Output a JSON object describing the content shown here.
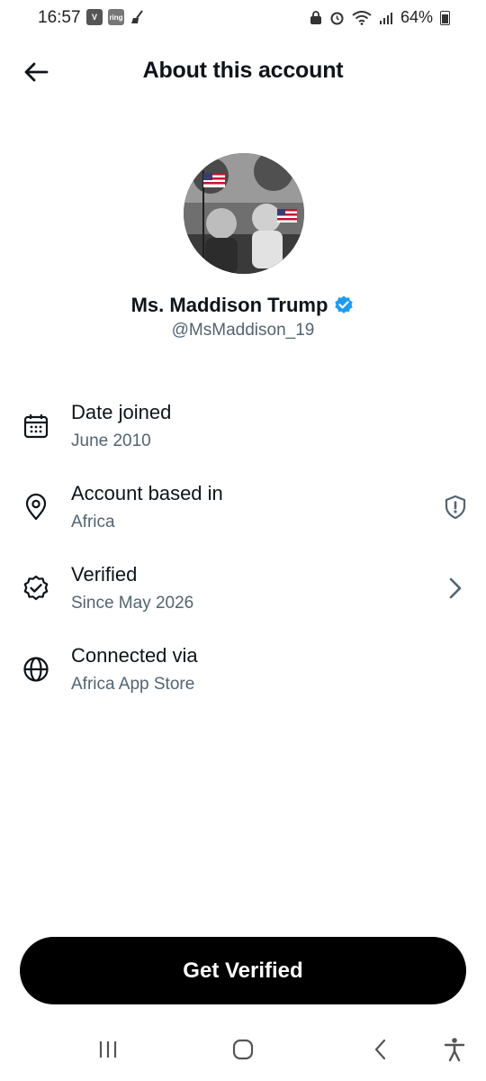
{
  "status_bar": {
    "time": "16:57",
    "left_icons": [
      "v-app-icon",
      "ring-app-icon",
      "broom-icon"
    ],
    "ring_label": "ring",
    "right_icons": [
      "lock-icon",
      "alarm-icon",
      "wifi-icon",
      "signal-icon"
    ],
    "battery": "64%"
  },
  "header": {
    "title": "About this account"
  },
  "profile": {
    "name": "Ms. Maddison Trump",
    "handle": "@MsMaddison_19",
    "verified_color": "#1d9bf0"
  },
  "details": [
    {
      "icon": "calendar-icon",
      "title": "Date joined",
      "value": "June 2010"
    },
    {
      "icon": "location-pin-icon",
      "title": "Account based in",
      "value": "Africa",
      "trailing_icon": "shield-alert-icon"
    },
    {
      "icon": "verified-outline-icon",
      "title": "Verified",
      "value": "Since May 2026",
      "trailing_icon": "chevron-right-icon"
    },
    {
      "icon": "globe-icon",
      "title": "Connected via",
      "value": "Africa App Store"
    }
  ],
  "cta": {
    "label": "Get Verified"
  },
  "nav_bar": [
    "recent-apps-icon",
    "home-icon",
    "back-icon",
    "accessibility-icon"
  ],
  "colors": {
    "text_primary": "#0f1419",
    "text_secondary": "#536471",
    "button_bg": "#000000"
  }
}
